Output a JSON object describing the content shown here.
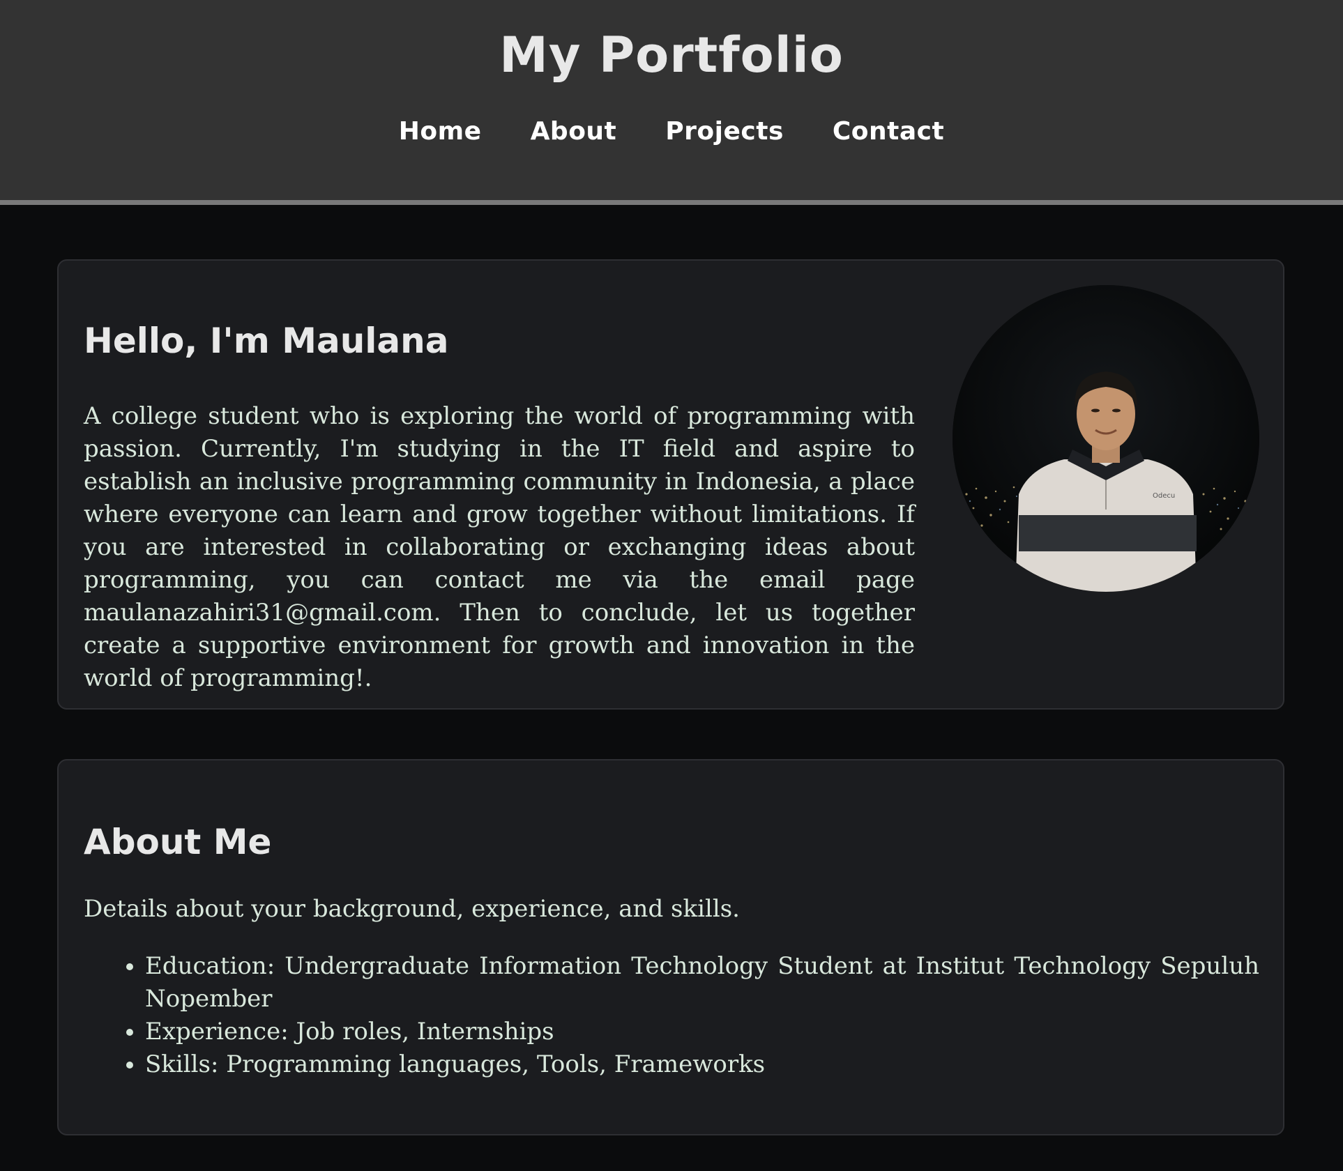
{
  "header": {
    "title": "My Portfolio",
    "nav": [
      "Home",
      "About",
      "Projects",
      "Contact"
    ]
  },
  "hero": {
    "heading": "Hello, I'm Maulana",
    "text": "A college student who is exploring the world of programming with passion. Currently, I'm studying in the IT field and aspire to establish an inclusive programming community in Indonesia, a place where everyone can learn and grow together without limitations. If you are interested in collaborating or exchanging ideas about programming, you can contact me via the email page maulanazahiri31@gmail.com. Then to conclude, let us together create a supportive environment for growth and innovation in the world of programming!.",
    "photo_label": "Odecu"
  },
  "about": {
    "heading": "About Me",
    "intro": "Details about your background, experience, and skills.",
    "items": [
      "Education: Undergraduate Information Technology Student at Institut Technology Sepuluh Nopember",
      "Experience: Job roles, Internships",
      "Skills: Programming languages, Tools, Frameworks"
    ]
  },
  "colors": {
    "header_bg": "#333333",
    "page_bg": "#0b0c0d",
    "card_bg": "#1b1c1f",
    "body_text": "#d9e8dc"
  }
}
